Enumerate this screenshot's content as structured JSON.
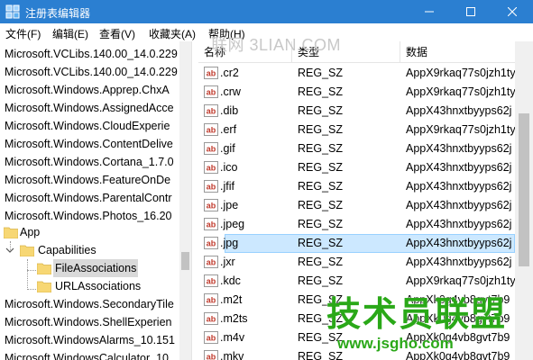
{
  "window": {
    "title": "注册表编辑器",
    "accent_color": "#2b7fd1"
  },
  "menu": [
    {
      "label": "文件(F)"
    },
    {
      "label": "编辑(E)"
    },
    {
      "label": "查看(V)"
    },
    {
      "label": "收藏夹(A)"
    },
    {
      "label": "帮助(H)"
    }
  ],
  "watermark": "联网 3LIAN.COM",
  "tree": {
    "items": [
      {
        "label": "Microsoft.VCLibs.140.00_14.0.229"
      },
      {
        "label": "Microsoft.VCLibs.140.00_14.0.229"
      },
      {
        "label": "Microsoft.Windows.Apprep.ChxA"
      },
      {
        "label": "Microsoft.Windows.AssignedAcce"
      },
      {
        "label": "Microsoft.Windows.CloudExperie"
      },
      {
        "label": "Microsoft.Windows.ContentDelive"
      },
      {
        "label": "Microsoft.Windows.Cortana_1.7.0"
      },
      {
        "label": "Microsoft.Windows.FeatureOnDe"
      },
      {
        "label": "Microsoft.Windows.ParentalContr"
      },
      {
        "label": "Microsoft.Windows.Photos_16.20"
      },
      {
        "label": "App"
      },
      {
        "label": "Capabilities"
      },
      {
        "label": "FileAssociations"
      },
      {
        "label": "URLAssociations"
      },
      {
        "label": "Microsoft.Windows.SecondaryTile"
      },
      {
        "label": "Microsoft.Windows.ShellExperien"
      },
      {
        "label": "Microsoft.WindowsAlarms_10.151"
      },
      {
        "label": "Microsoft.WindowsCalculator_10"
      }
    ]
  },
  "list": {
    "headers": {
      "name": "名称",
      "type": "类型",
      "data": "数据"
    },
    "rows": [
      {
        "name": ".cr2",
        "type": "REG_SZ",
        "data": "AppX9rkaq77s0jzh1ty"
      },
      {
        "name": ".crw",
        "type": "REG_SZ",
        "data": "AppX9rkaq77s0jzh1ty"
      },
      {
        "name": ".dib",
        "type": "REG_SZ",
        "data": "AppX43hnxtbyyps62j"
      },
      {
        "name": ".erf",
        "type": "REG_SZ",
        "data": "AppX9rkaq77s0jzh1ty"
      },
      {
        "name": ".gif",
        "type": "REG_SZ",
        "data": "AppX43hnxtbyyps62j"
      },
      {
        "name": ".ico",
        "type": "REG_SZ",
        "data": "AppX43hnxtbyyps62j"
      },
      {
        "name": ".jfif",
        "type": "REG_SZ",
        "data": "AppX43hnxtbyyps62j"
      },
      {
        "name": ".jpe",
        "type": "REG_SZ",
        "data": "AppX43hnxtbyyps62j"
      },
      {
        "name": ".jpeg",
        "type": "REG_SZ",
        "data": "AppX43hnxtbyyps62j"
      },
      {
        "name": ".jpg",
        "type": "REG_SZ",
        "data": "AppX43hnxtbyyps62j"
      },
      {
        "name": ".jxr",
        "type": "REG_SZ",
        "data": "AppX43hnxtbyyps62j"
      },
      {
        "name": ".kdc",
        "type": "REG_SZ",
        "data": "AppX9rkaq77s0jzh1ty"
      },
      {
        "name": ".m2t",
        "type": "REG_SZ",
        "data": "AppXk0g4vb8gvt7b9"
      },
      {
        "name": ".m2ts",
        "type": "REG_SZ",
        "data": "AppXk0g4vb8gvt7b9"
      },
      {
        "name": ".m4v",
        "type": "REG_SZ",
        "data": "AppXk0g4vb8gvt7b9"
      },
      {
        "name": ".mkv",
        "type": "REG_SZ",
        "data": "AppXk0g4vb8gvt7b9"
      }
    ]
  },
  "brand": {
    "name": "技术员联盟",
    "url": "www.jsgho.com",
    "color": "#2aa818"
  }
}
